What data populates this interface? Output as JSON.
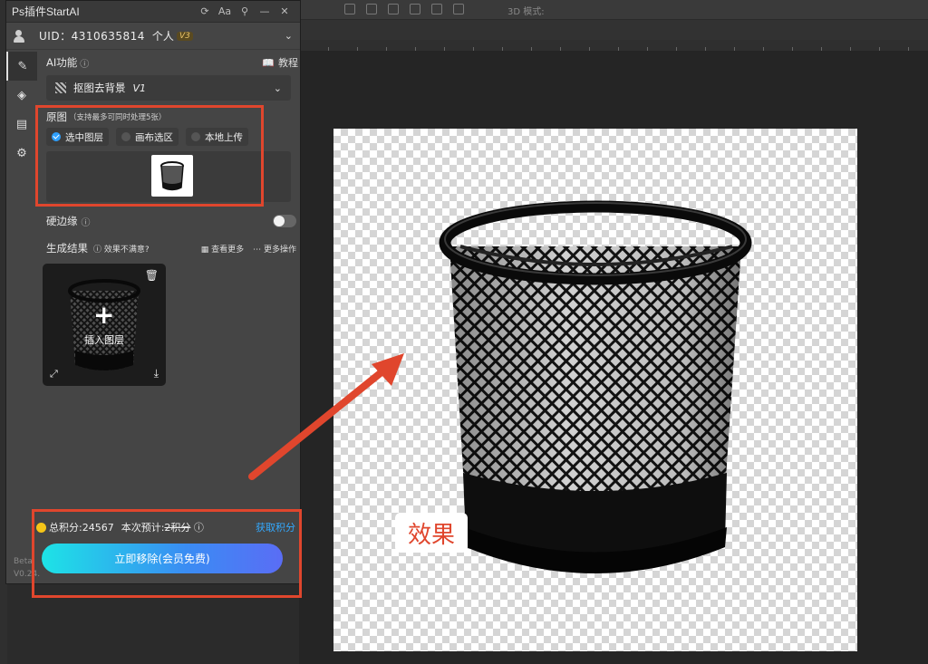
{
  "panel": {
    "title": "Ps插件StartAI",
    "uid": "UID：4310635814",
    "plan": "个人",
    "plan_badge": "V3"
  },
  "ai_function": {
    "label": "AI功能",
    "tutorial": "教程",
    "selected": "抠图去背景",
    "version": "V1"
  },
  "source": {
    "label": "原图",
    "hint": "（支持最多可同时处理5张）",
    "options": [
      "选中图层",
      "画布选区",
      "本地上传"
    ],
    "selected_index": 0
  },
  "hard_edge": {
    "label": "硬边缘",
    "enabled": false
  },
  "results": {
    "label": "生成结果",
    "feedback": "效果不满意?",
    "view_more": "查看更多",
    "more_ops": "更多操作",
    "insert_label": "插入图层"
  },
  "footer": {
    "total_points": "总积分:24567",
    "estimate_label": "本次预计:",
    "estimate_value": "2积分",
    "get_points": "获取积分",
    "action_button": "立即移除(会员免费)",
    "version_line1": "Beta",
    "version_line2": "V0.24."
  },
  "canvas": {
    "effect_label": "效果"
  },
  "colors": {
    "highlight": "#e0462d",
    "accent_blue": "#33a9ff",
    "button_gradient_start": "#1de3e6",
    "button_gradient_end": "#5a6df5"
  },
  "ps_toolbar": {
    "mode_text": "3D 模式:"
  }
}
